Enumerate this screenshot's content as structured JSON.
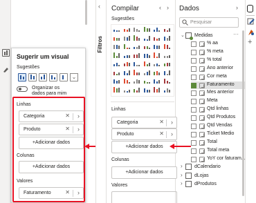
{
  "popup": {
    "title": "Sugerir um visual",
    "sugestoes_label": "Sugestões",
    "toggle_label": "Organizar os dados para mim",
    "linhas_label": "Linhas",
    "linhas_fields": [
      "Categoria",
      "Produto"
    ],
    "add_label": "+Adicionar dados",
    "colunas_label": "Colunas",
    "valores_label": "Valores",
    "valores_fields": [
      "Faturamento"
    ]
  },
  "filtros_tab": "Filtros",
  "compilar": {
    "title": "Compilar",
    "sugestoes_label": "Sugestões",
    "linhas_label": "Linhas",
    "linhas_fields": [
      "Categoria",
      "Produto"
    ],
    "add_label": "+Adicionar dados",
    "colunas_label": "Colunas",
    "valores_label": "Valores"
  },
  "dados": {
    "title": "Dados",
    "search_placeholder": "Pesquisar",
    "medidas_label": "Medidas",
    "fields": [
      {
        "label": "% aa",
        "checked": false
      },
      {
        "label": "% meta",
        "checked": false
      },
      {
        "label": "% total",
        "checked": false
      },
      {
        "label": "Ano anterior",
        "checked": false
      },
      {
        "label": "Cor meta",
        "checked": false
      },
      {
        "label": "Faturamento",
        "checked": true
      },
      {
        "label": "Mes anterior",
        "checked": false
      },
      {
        "label": "Meta",
        "checked": false
      },
      {
        "label": "Qtd linhas",
        "checked": false
      },
      {
        "label": "Qtd Produtos",
        "checked": false
      },
      {
        "label": "Qtd Vendas",
        "checked": false
      },
      {
        "label": "Ticket Medio",
        "checked": false
      },
      {
        "label": "Total",
        "checked": false
      },
      {
        "label": "Total meta",
        "checked": false
      },
      {
        "label": "YoY cor faturam...",
        "checked": false
      }
    ],
    "tables": [
      "dCalendario",
      "dLojas",
      "dProdutos"
    ]
  },
  "colors": {
    "highlight": "#e81123",
    "accent": "#5d8a3a",
    "selected_row": "#e1e1e1"
  }
}
